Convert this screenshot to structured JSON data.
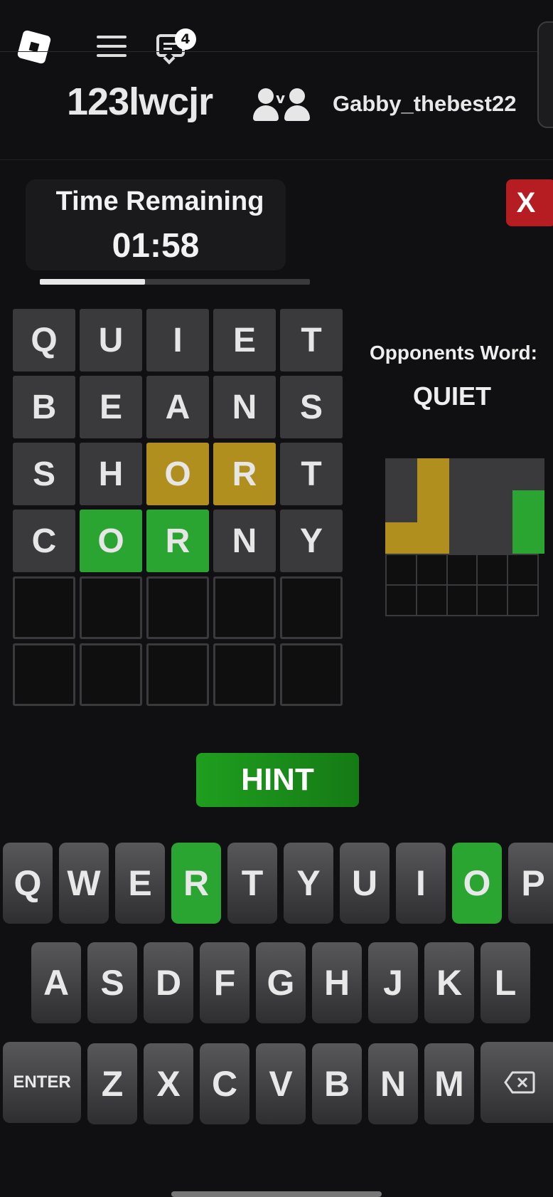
{
  "topbar": {
    "chat_badge": "4"
  },
  "players": {
    "left": "123lwcjr",
    "vs": "v",
    "right": "Gabby_thebest22"
  },
  "timer": {
    "label": "Time Remaining",
    "value": "01:58",
    "progress": 0.39
  },
  "close_label": "X",
  "board": [
    [
      {
        "l": "Q",
        "s": "absent"
      },
      {
        "l": "U",
        "s": "absent"
      },
      {
        "l": "I",
        "s": "absent"
      },
      {
        "l": "E",
        "s": "absent"
      },
      {
        "l": "T",
        "s": "absent"
      }
    ],
    [
      {
        "l": "B",
        "s": "absent"
      },
      {
        "l": "E",
        "s": "absent"
      },
      {
        "l": "A",
        "s": "absent"
      },
      {
        "l": "N",
        "s": "absent"
      },
      {
        "l": "S",
        "s": "absent"
      }
    ],
    [
      {
        "l": "S",
        "s": "absent"
      },
      {
        "l": "H",
        "s": "absent"
      },
      {
        "l": "O",
        "s": "present"
      },
      {
        "l": "R",
        "s": "present"
      },
      {
        "l": "T",
        "s": "absent"
      }
    ],
    [
      {
        "l": "C",
        "s": "absent"
      },
      {
        "l": "O",
        "s": "correct"
      },
      {
        "l": "R",
        "s": "correct"
      },
      {
        "l": "N",
        "s": "absent"
      },
      {
        "l": "Y",
        "s": "absent"
      }
    ],
    [
      {
        "l": "",
        "s": "empty"
      },
      {
        "l": "",
        "s": "empty"
      },
      {
        "l": "",
        "s": "empty"
      },
      {
        "l": "",
        "s": "empty"
      },
      {
        "l": "",
        "s": "empty"
      }
    ],
    [
      {
        "l": "",
        "s": "empty"
      },
      {
        "l": "",
        "s": "empty"
      },
      {
        "l": "",
        "s": "empty"
      },
      {
        "l": "",
        "s": "empty"
      },
      {
        "l": "",
        "s": "empty"
      }
    ]
  ],
  "opponent": {
    "label": "Opponents Word:",
    "word": "QUIET",
    "grid": [
      [
        "absent",
        "present",
        "absent",
        "absent",
        "absent"
      ],
      [
        "absent",
        "present",
        "absent",
        "absent",
        "correct"
      ],
      [
        "present",
        "present",
        "absent",
        "absent",
        "correct"
      ],
      [
        "empty",
        "empty",
        "empty",
        "empty",
        "empty"
      ],
      [
        "empty",
        "empty",
        "empty",
        "empty",
        "empty"
      ]
    ]
  },
  "hint_label": "HINT",
  "keyboard": {
    "row1": [
      "Q",
      "W",
      "E",
      "R",
      "T",
      "Y",
      "U",
      "I",
      "O",
      "P"
    ],
    "row2": [
      "A",
      "S",
      "D",
      "F",
      "G",
      "H",
      "J",
      "K",
      "L"
    ],
    "row3": [
      "ENTER",
      "Z",
      "X",
      "C",
      "V",
      "B",
      "N",
      "M"
    ],
    "green_keys": [
      "R",
      "O"
    ]
  },
  "colors": {
    "correct": "#2ba532",
    "present": "#b18f1f",
    "absent": "#3a3a3c",
    "close": "#b61d22",
    "hint": "#1f9e1f"
  }
}
